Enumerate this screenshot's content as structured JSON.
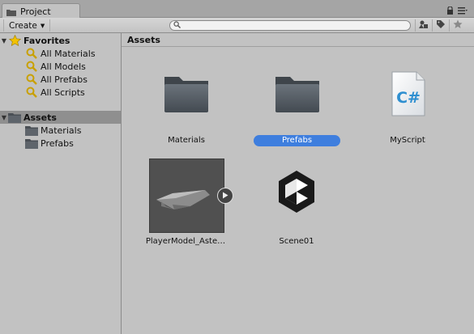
{
  "tab": {
    "title": "Project"
  },
  "toolbar": {
    "create_label": "Create",
    "search": {
      "value": "",
      "placeholder": ""
    }
  },
  "sidebar": {
    "favorites": {
      "label": "Favorites",
      "items": [
        "All Materials",
        "All Models",
        "All Prefabs",
        "All Scripts"
      ]
    },
    "assets": {
      "label": "Assets",
      "items": [
        "Materials",
        "Prefabs"
      ]
    }
  },
  "content": {
    "breadcrumb": "Assets",
    "items": [
      {
        "name": "Materials",
        "type": "folder",
        "selected": false
      },
      {
        "name": "Prefabs",
        "type": "folder",
        "selected": true
      },
      {
        "name": "MyScript",
        "type": "csharp-script",
        "selected": false
      },
      {
        "name": "PlayerModel_Aste…",
        "type": "model",
        "selected": false
      },
      {
        "name": "Scene01",
        "type": "unity-scene",
        "selected": false
      }
    ]
  },
  "colors": {
    "selection": "#3e7ede",
    "panel": "#c2c2c2",
    "tabbar": "#a5a5a5"
  },
  "icons": [
    "lock-icon",
    "menu-icon",
    "search-icon",
    "filter-by-type-icon",
    "label-icon",
    "favorite-star-icon",
    "star-icon",
    "search-icon",
    "folder-icon",
    "csharp-script-icon",
    "unity-logo-icon",
    "play-icon"
  ]
}
